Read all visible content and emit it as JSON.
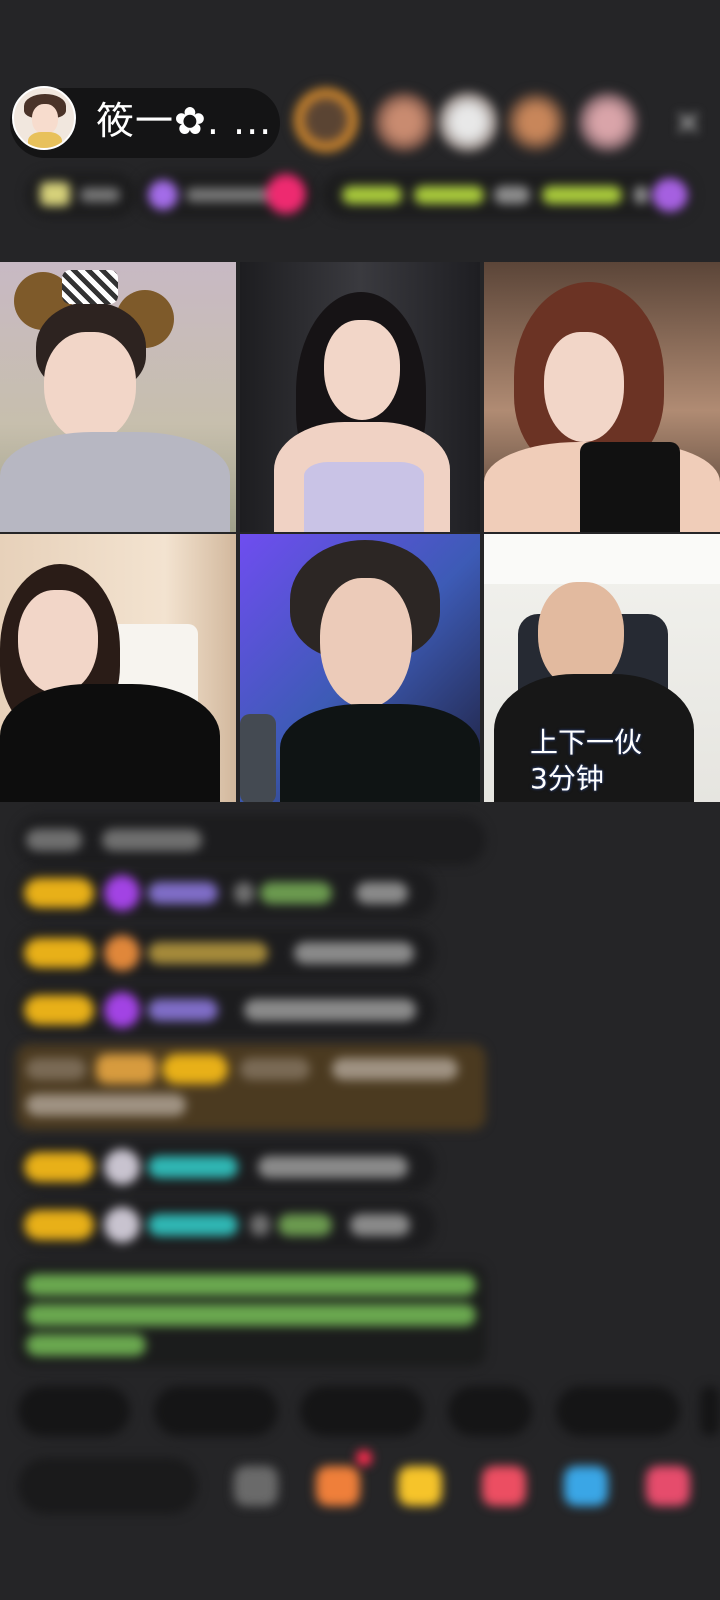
{
  "host": {
    "name": "筱一✿. ...",
    "avatar_icon": "host-avatar"
  },
  "top_bar": {
    "viewers": [
      "viewer-avatar",
      "viewer-avatar",
      "viewer-avatar",
      "viewer-avatar",
      "viewer-avatar"
    ],
    "close_icon": "close-icon",
    "close_glyph": "✕"
  },
  "video_grid": {
    "cells": [
      {
        "name": "guest-1"
      },
      {
        "name": "guest-2"
      },
      {
        "name": "guest-3"
      },
      {
        "name": "guest-4"
      },
      {
        "name": "guest-5"
      },
      {
        "name": "guest-6"
      }
    ],
    "overlay_line_1": "上下一伙",
    "overlay_line_2": "3分钟"
  },
  "colors": {
    "background": "#252527",
    "badge_gold": "#e8b018",
    "chat_teal": "#2fb6b3",
    "chat_green": "#7ec85a",
    "gold_bubble": "#4b3a20"
  }
}
